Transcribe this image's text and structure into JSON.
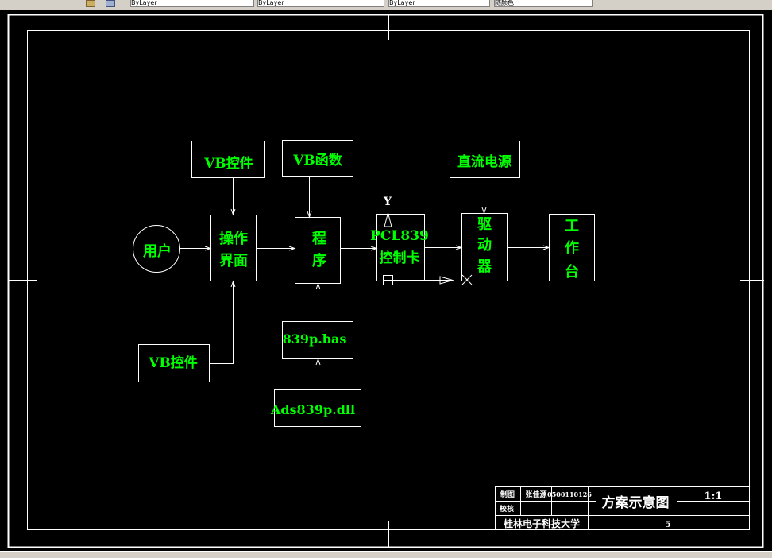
{
  "toolbar": {
    "fields": [
      "ByLayer",
      "ByLayer",
      "ByLayer",
      "随颜色"
    ]
  },
  "diagram": {
    "nodes": {
      "user": "用户",
      "ui_line1": "操作",
      "ui_line2": "界面",
      "program_line1": "程",
      "program_line2": "序",
      "card_line1": "PCL839",
      "card_line2": "控制卡",
      "driver_line1": "驱",
      "driver_line2": "动",
      "driver_line3": "器",
      "table_line1": "工",
      "table_line2": "作",
      "table_line3": "台",
      "vb_control_top": "VB控件",
      "vb_function": "VB函数",
      "dc_power": "直流电源",
      "vb_control_bottom": "VB控件",
      "bas_file": "839p.bas",
      "dll_file": "Ads839p.dll"
    },
    "ucs_y_label": "Y"
  },
  "title_block": {
    "draw_label": "制图",
    "draw_name": "张佳源",
    "student_id": "0500110126",
    "check_label": "校核",
    "drawing_title": "方案示意图",
    "scale": "1:1",
    "school": "桂林电子科技大学",
    "sheet_no": "5"
  }
}
